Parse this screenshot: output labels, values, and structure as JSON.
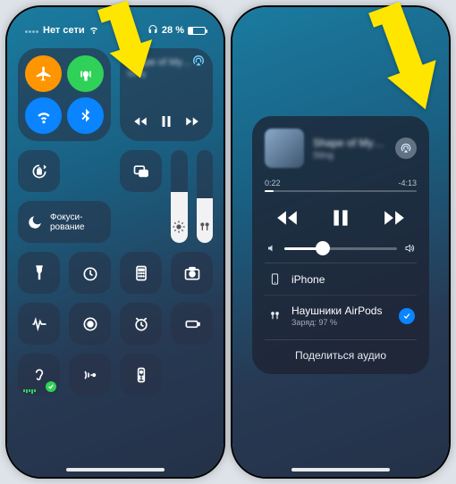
{
  "status": {
    "carrier": "Нет сети",
    "battery_pct": "28 %"
  },
  "connectivity": {
    "airplane": "airplane-icon",
    "cellular": "antenna-icon",
    "wifi": "wifi-icon",
    "bluetooth": "bluetooth-icon"
  },
  "now_playing_mini": {
    "title_blurred": "Shape of My…",
    "subtitle_blurred": "Sting"
  },
  "focus": {
    "label": "Фокуси-\nрование"
  },
  "sliders": {
    "brightness_pct": 55,
    "volume_pct": 48
  },
  "right_panel": {
    "elapsed": "0:22",
    "remaining": "-4:13",
    "devices": [
      {
        "icon": "phone",
        "name": "iPhone",
        "sub": "",
        "selected": false
      },
      {
        "icon": "airpods",
        "name": "Наушники AirPods",
        "sub": "Заряд: 97 %",
        "selected": true
      }
    ],
    "share_label": "Поделиться аудио"
  }
}
